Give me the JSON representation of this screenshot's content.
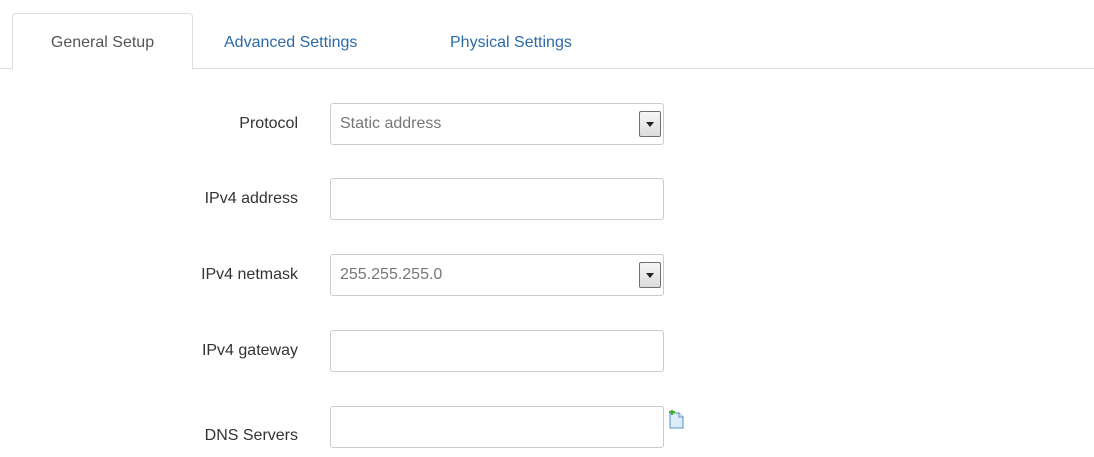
{
  "tabs": [
    {
      "label": "General Setup",
      "active": true
    },
    {
      "label": "Advanced Settings",
      "active": false
    },
    {
      "label": "Physical Settings",
      "active": false
    }
  ],
  "form": {
    "protocol": {
      "label": "Protocol",
      "value": "Static address"
    },
    "ipv4_address": {
      "label": "IPv4 address",
      "value": ""
    },
    "ipv4_netmask": {
      "label": "IPv4 netmask",
      "value": "255.255.255.0"
    },
    "ipv4_gateway": {
      "label": "IPv4 gateway",
      "value": ""
    },
    "dns_servers": {
      "label": "DNS Servers",
      "value": "",
      "add_icon": "add-entry-icon"
    }
  },
  "colors": {
    "tab_link": "#2c6aa6",
    "active_tab_text": "#555555",
    "border": "#cccccc"
  }
}
